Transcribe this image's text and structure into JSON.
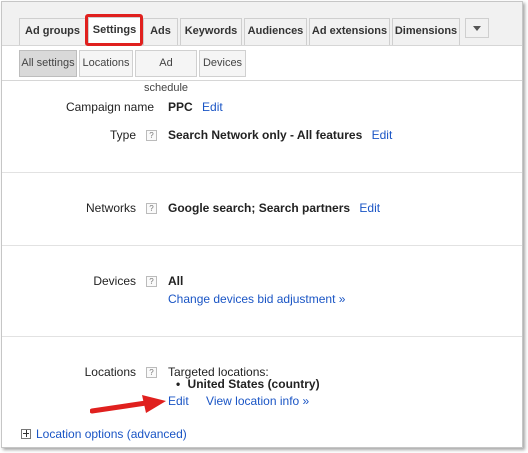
{
  "tabs": [
    "Ad groups",
    "Settings",
    "Ads",
    "Keywords",
    "Audiences",
    "Ad extensions",
    "Dimensions"
  ],
  "sub_tabs": [
    "All settings",
    "Locations",
    "Ad schedule",
    "Devices"
  ],
  "settings": {
    "campaign_name": {
      "label": "Campaign name",
      "value": "PPC",
      "edit": "Edit"
    },
    "type": {
      "label": "Type",
      "help": "?",
      "value": "Search Network only - All features",
      "edit": "Edit"
    },
    "networks": {
      "label": "Networks",
      "help": "?",
      "value": "Google search; Search partners",
      "edit": "Edit"
    },
    "devices": {
      "label": "Devices",
      "help": "?",
      "value": "All",
      "link": "Change devices bid adjustment »"
    },
    "locations": {
      "label": "Locations",
      "help": "?",
      "targeted_label": "Targeted locations:",
      "bullet": "•",
      "items": [
        "United States (country)"
      ],
      "edit": "Edit",
      "view": "View location info »"
    }
  },
  "location_options": "Location options (advanced)",
  "colors": {
    "link": "#1a55c5",
    "highlight": "#e0201e"
  }
}
